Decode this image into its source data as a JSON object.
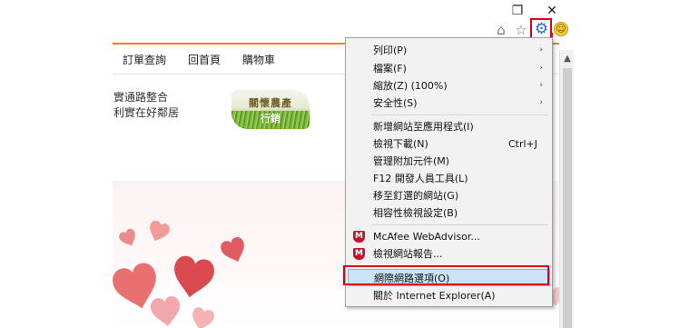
{
  "window": {
    "restore_glyph": "❐",
    "close_glyph": "✕"
  },
  "toolbar": {
    "home_glyph": "⌂",
    "star_glyph": "☆",
    "gear_glyph": "⚙",
    "smiley_glyph": "☺"
  },
  "page": {
    "nav": [
      "訂單查詢",
      "回首頁",
      "購物車"
    ],
    "promo_lines": [
      "實通路整合",
      "利實在好鄰居"
    ],
    "banner": {
      "line1": "關懷農產",
      "line2": "行銷"
    }
  },
  "menu": {
    "items": [
      {
        "label": "列印(P)",
        "submenu": true
      },
      {
        "label": "檔案(F)",
        "submenu": true
      },
      {
        "label": "縮放(Z) (100%)",
        "submenu": true
      },
      {
        "label": "安全性(S)",
        "submenu": true
      },
      {
        "label": "新增網站至應用程式(I)"
      },
      {
        "label": "檢視下載(N)",
        "shortcut": "Ctrl+J"
      },
      {
        "label": "管理附加元件(M)"
      },
      {
        "label": "F12 開發人員工具(L)"
      },
      {
        "label": "移至釘選的網站(G)"
      },
      {
        "label": "相容性檢視設定(B)"
      },
      {
        "label": "McAfee WebAdvisor...",
        "icon": "mcafee-icon"
      },
      {
        "label": "檢視網站報告...",
        "icon": "mcafee-icon"
      },
      {
        "label": "網際網路選項(O)",
        "highlighted": true
      },
      {
        "label": "關於 Internet Explorer(A)"
      }
    ],
    "submenu_glyph": "›",
    "mcafee_glyph": "M"
  },
  "colors": {
    "highlight_frame": "#e0001b",
    "gear": "#1f6fd1",
    "menu_selected_bg": "#cce4f7",
    "page_accent": "#f07b38"
  }
}
